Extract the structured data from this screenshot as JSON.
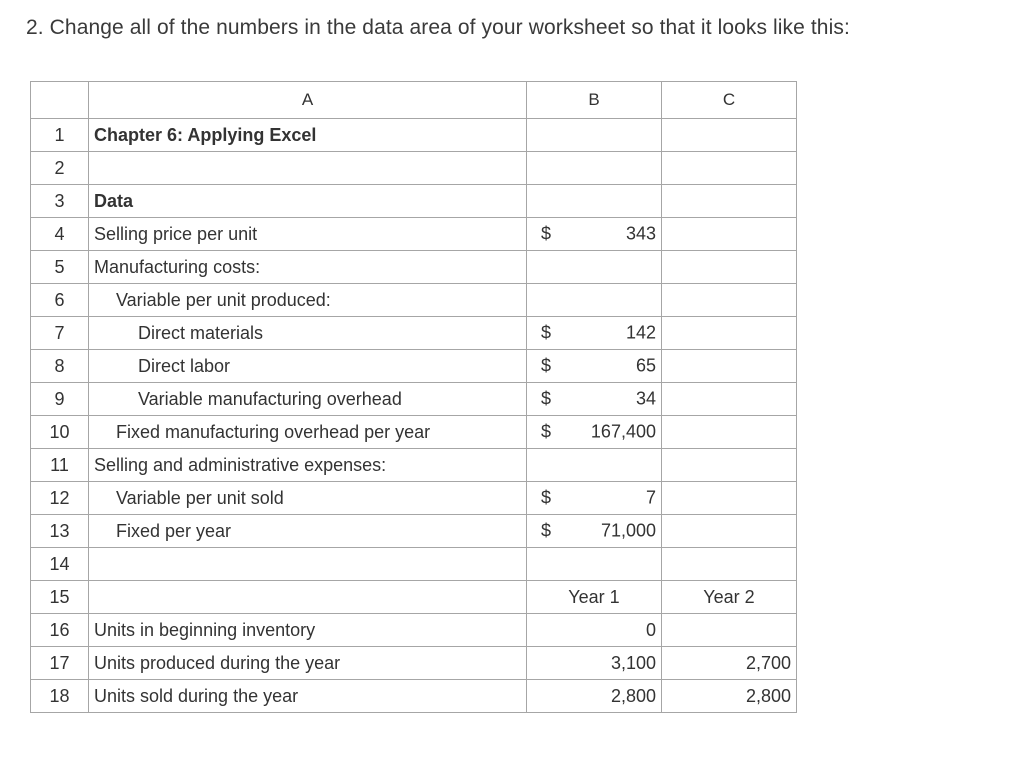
{
  "instruction": "2. Change all of the numbers in the data area of your worksheet so that it looks like this:",
  "columns": [
    "A",
    "B",
    "C"
  ],
  "rows": [
    {
      "n": "1",
      "a": "Chapter 6: Applying Excel",
      "b": "",
      "c": ""
    },
    {
      "n": "2",
      "a": "",
      "b": "",
      "c": ""
    },
    {
      "n": "3",
      "a": "Data",
      "b": "",
      "c": ""
    },
    {
      "n": "4",
      "a": "Selling price per unit",
      "dollar": "$",
      "b": "343",
      "c": ""
    },
    {
      "n": "5",
      "a": "Manufacturing costs:",
      "b": "",
      "c": ""
    },
    {
      "n": "6",
      "a": "Variable per unit produced:",
      "b": "",
      "c": ""
    },
    {
      "n": "7",
      "a": "Direct materials",
      "dollar": "$",
      "b": "142",
      "c": ""
    },
    {
      "n": "8",
      "a": "Direct labor",
      "dollar": "$",
      "b": "65",
      "c": ""
    },
    {
      "n": "9",
      "a": "Variable manufacturing overhead",
      "dollar": "$",
      "b": "34",
      "c": ""
    },
    {
      "n": "10",
      "a": "Fixed manufacturing overhead per year",
      "dollar": "$",
      "b": "167,400",
      "c": ""
    },
    {
      "n": "11",
      "a": "Selling and administrative expenses:",
      "b": "",
      "c": ""
    },
    {
      "n": "12",
      "a": "Variable per unit sold",
      "dollar": "$",
      "b": "7",
      "c": ""
    },
    {
      "n": "13",
      "a": "Fixed per year",
      "dollar": "$",
      "b": "71,000",
      "c": ""
    },
    {
      "n": "14",
      "a": "",
      "b": "",
      "c": ""
    },
    {
      "n": "15",
      "a": "",
      "b": "Year 1",
      "c": "Year 2"
    },
    {
      "n": "16",
      "a": "Units in beginning inventory",
      "b": "0",
      "c": ""
    },
    {
      "n": "17",
      "a": "Units produced during the year",
      "b": "3,100",
      "c": "2,700"
    },
    {
      "n": "18",
      "a": "Units sold during the year",
      "b": "2,800",
      "c": "2,800"
    }
  ]
}
